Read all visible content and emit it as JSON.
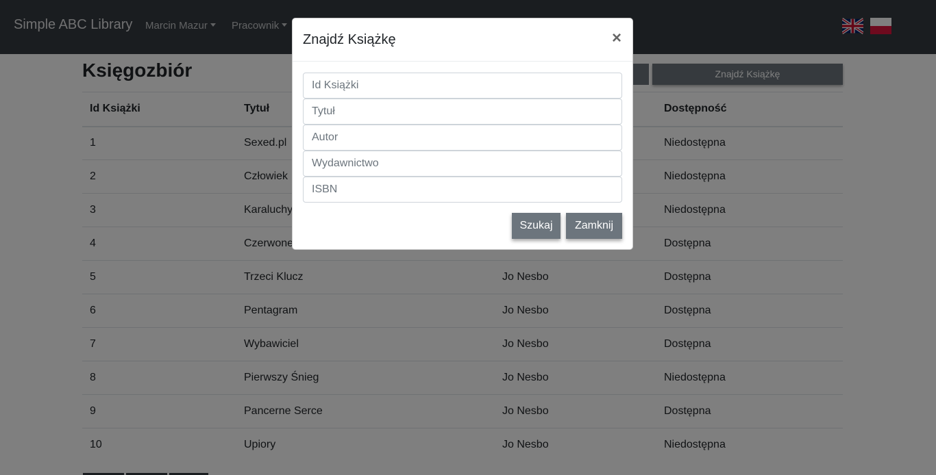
{
  "navbar": {
    "brand": "Simple ABC Library",
    "user_menu": "Marcin Mazur",
    "role_menu": "Pracownik",
    "flags": [
      "uk-flag",
      "poland-flag"
    ]
  },
  "page": {
    "title": "Księgozbiór",
    "find_button": "Znajdź Książkę"
  },
  "table": {
    "headers": [
      "Id Książki",
      "Tytuł",
      "",
      "Dostępność"
    ],
    "rows": [
      {
        "id": "1",
        "title": "Sexed.pl",
        "author": "",
        "availability": "Niedostępna"
      },
      {
        "id": "2",
        "title": "Człowiek",
        "author": "",
        "availability": "Niedostępna"
      },
      {
        "id": "3",
        "title": "Karaluchy",
        "author": "",
        "availability": "Niedostępna"
      },
      {
        "id": "4",
        "title": "Czerwone",
        "author": "",
        "availability": "Dostępna"
      },
      {
        "id": "5",
        "title": "Trzeci Klucz",
        "author": "Jo Nesbo",
        "availability": "Dostępna"
      },
      {
        "id": "6",
        "title": "Pentagram",
        "author": "Jo Nesbo",
        "availability": "Dostępna"
      },
      {
        "id": "7",
        "title": "Wybawiciel",
        "author": "Jo Nesbo",
        "availability": "Dostępna"
      },
      {
        "id": "8",
        "title": "Pierwszy Śnieg",
        "author": "Jo Nesbo",
        "availability": "Niedostępna"
      },
      {
        "id": "9",
        "title": "Pancerne Serce",
        "author": "Jo Nesbo",
        "availability": "Dostępna"
      },
      {
        "id": "10",
        "title": "Upiory",
        "author": "Jo Nesbo",
        "availability": "Niedostępna"
      }
    ]
  },
  "modal": {
    "title": "Znajdź Książkę",
    "close_symbol": "×",
    "fields": {
      "id_placeholder": "Id Książki",
      "title_placeholder": "Tytuł",
      "author_placeholder": "Autor",
      "publisher_placeholder": "Wydawnictwo",
      "isbn_placeholder": "ISBN"
    },
    "search_button": "Szukaj",
    "close_button": "Zamknij"
  },
  "colors": {
    "navbar": "#343a40",
    "button": "#6c757d",
    "backdrop": "rgba(0,0,0,0.5)"
  }
}
